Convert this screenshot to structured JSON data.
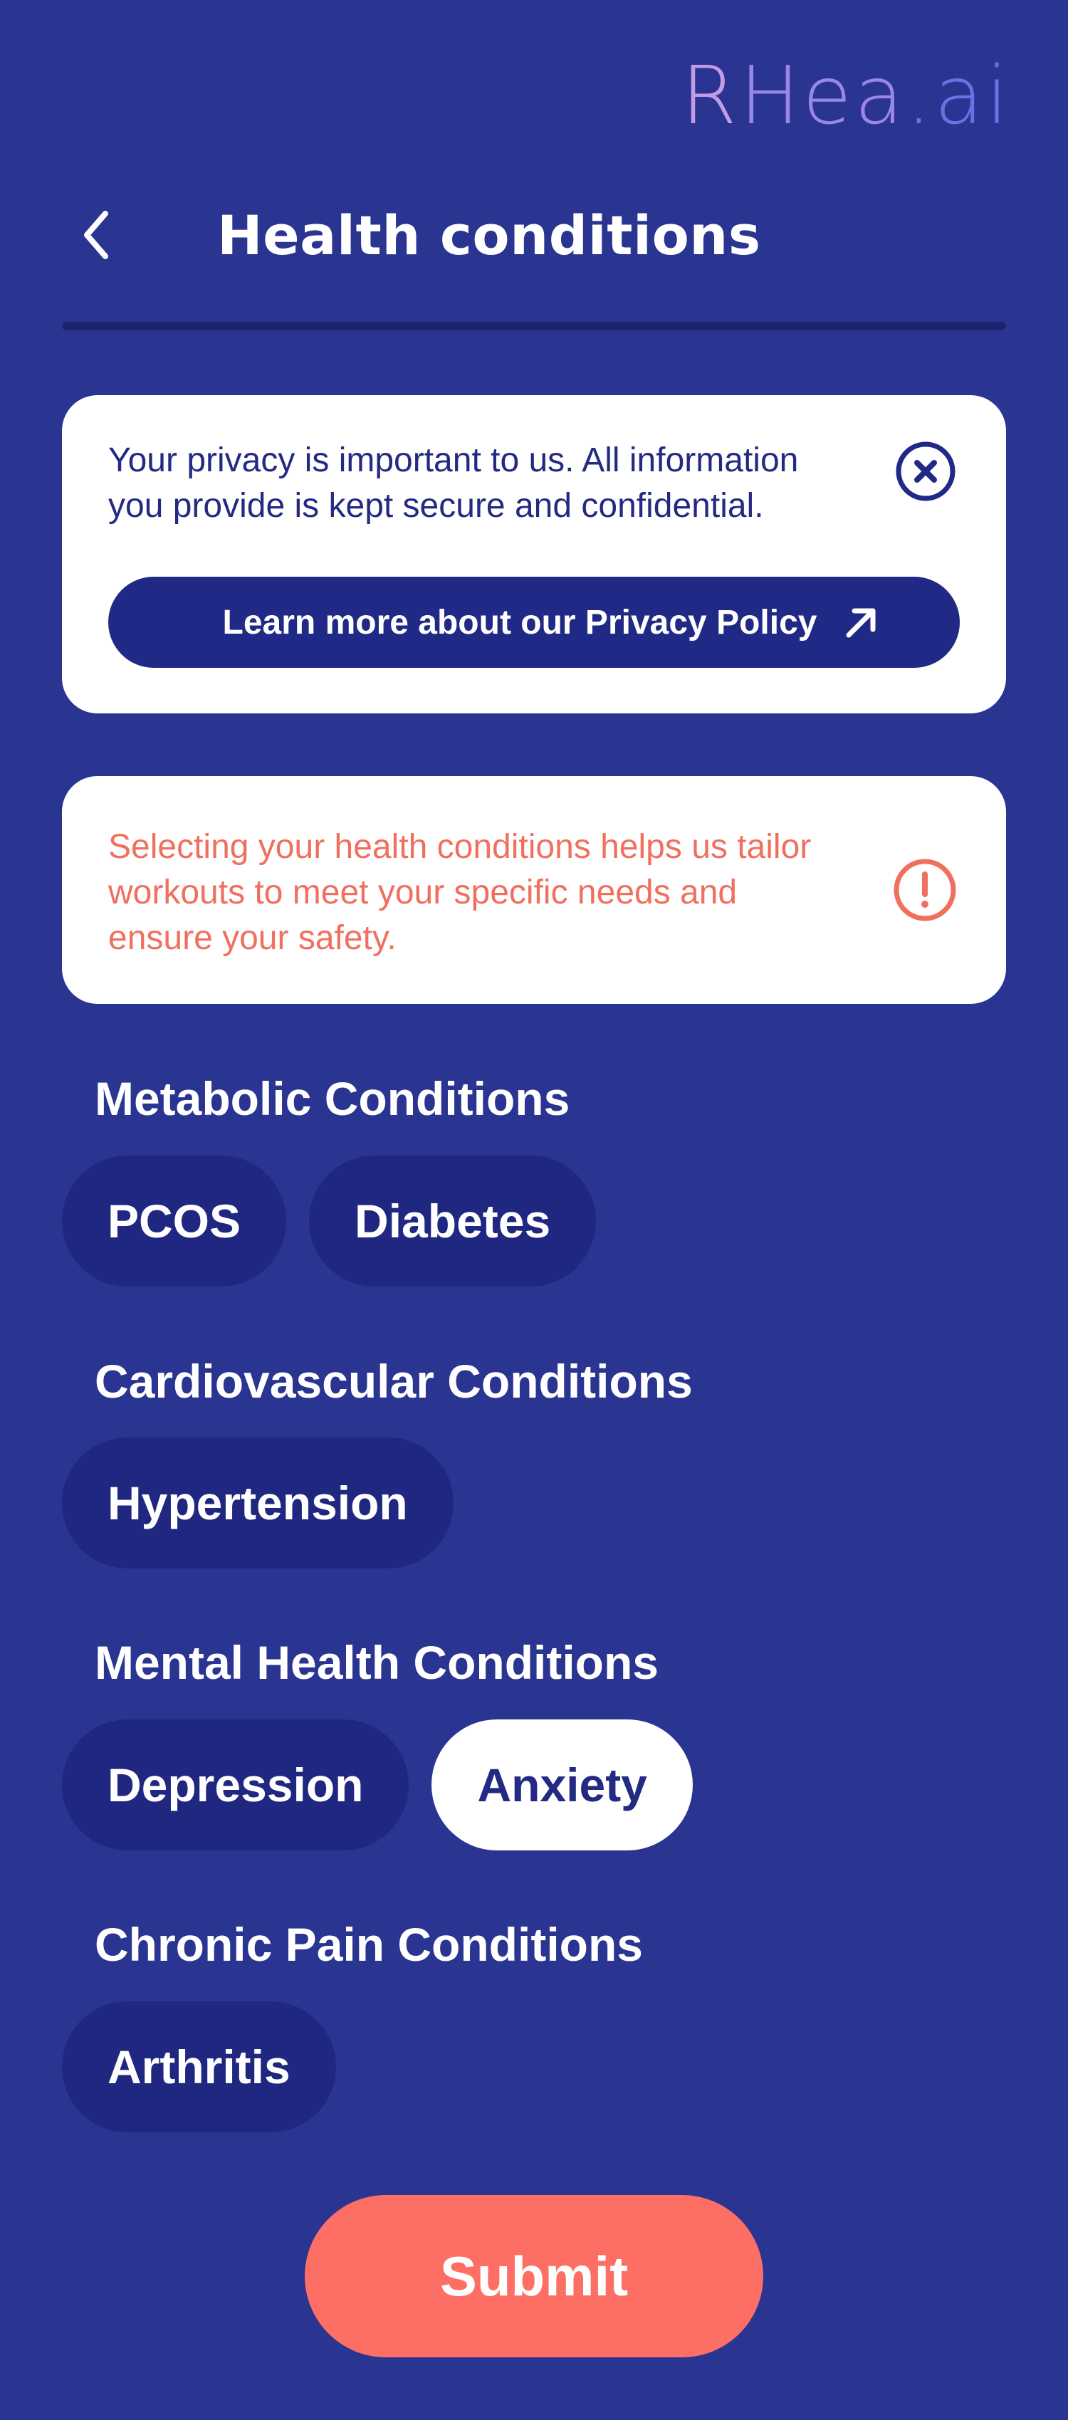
{
  "logo": {
    "part1": "R",
    "part2": "Hea",
    "part3": ".ai"
  },
  "header": {
    "title": "Health conditions"
  },
  "privacy_card": {
    "text": "Your privacy is important to us. All information you provide is kept secure and confidential.",
    "button_label": "Learn more about our Privacy Policy"
  },
  "info_card": {
    "text": "Selecting your health conditions helps us tailor workouts to meet your specific needs and ensure your safety."
  },
  "sections": [
    {
      "title": "Metabolic Conditions",
      "chips": [
        {
          "label": "PCOS",
          "selected": false
        },
        {
          "label": "Diabetes",
          "selected": false
        }
      ]
    },
    {
      "title": "Cardiovascular Conditions",
      "chips": [
        {
          "label": "Hypertension",
          "selected": false
        }
      ]
    },
    {
      "title": "Mental Health Conditions",
      "chips": [
        {
          "label": "Depression",
          "selected": false
        },
        {
          "label": "Anxiety",
          "selected": true
        }
      ]
    },
    {
      "title": "Chronic Pain Conditions",
      "chips": [
        {
          "label": "Arthritis",
          "selected": false
        }
      ]
    }
  ],
  "submit": {
    "label": "Submit"
  },
  "colors": {
    "background": "#2a3491",
    "chip": "#1f2780",
    "chip_selected": "#ffffff",
    "accent": "#fd6f64",
    "info_text": "#f0705f",
    "dark_text": "#232a82"
  },
  "icons": {
    "back": "chevron-left-icon",
    "close": "close-circle-icon",
    "external": "arrow-up-right-icon",
    "alert": "alert-circle-icon"
  }
}
